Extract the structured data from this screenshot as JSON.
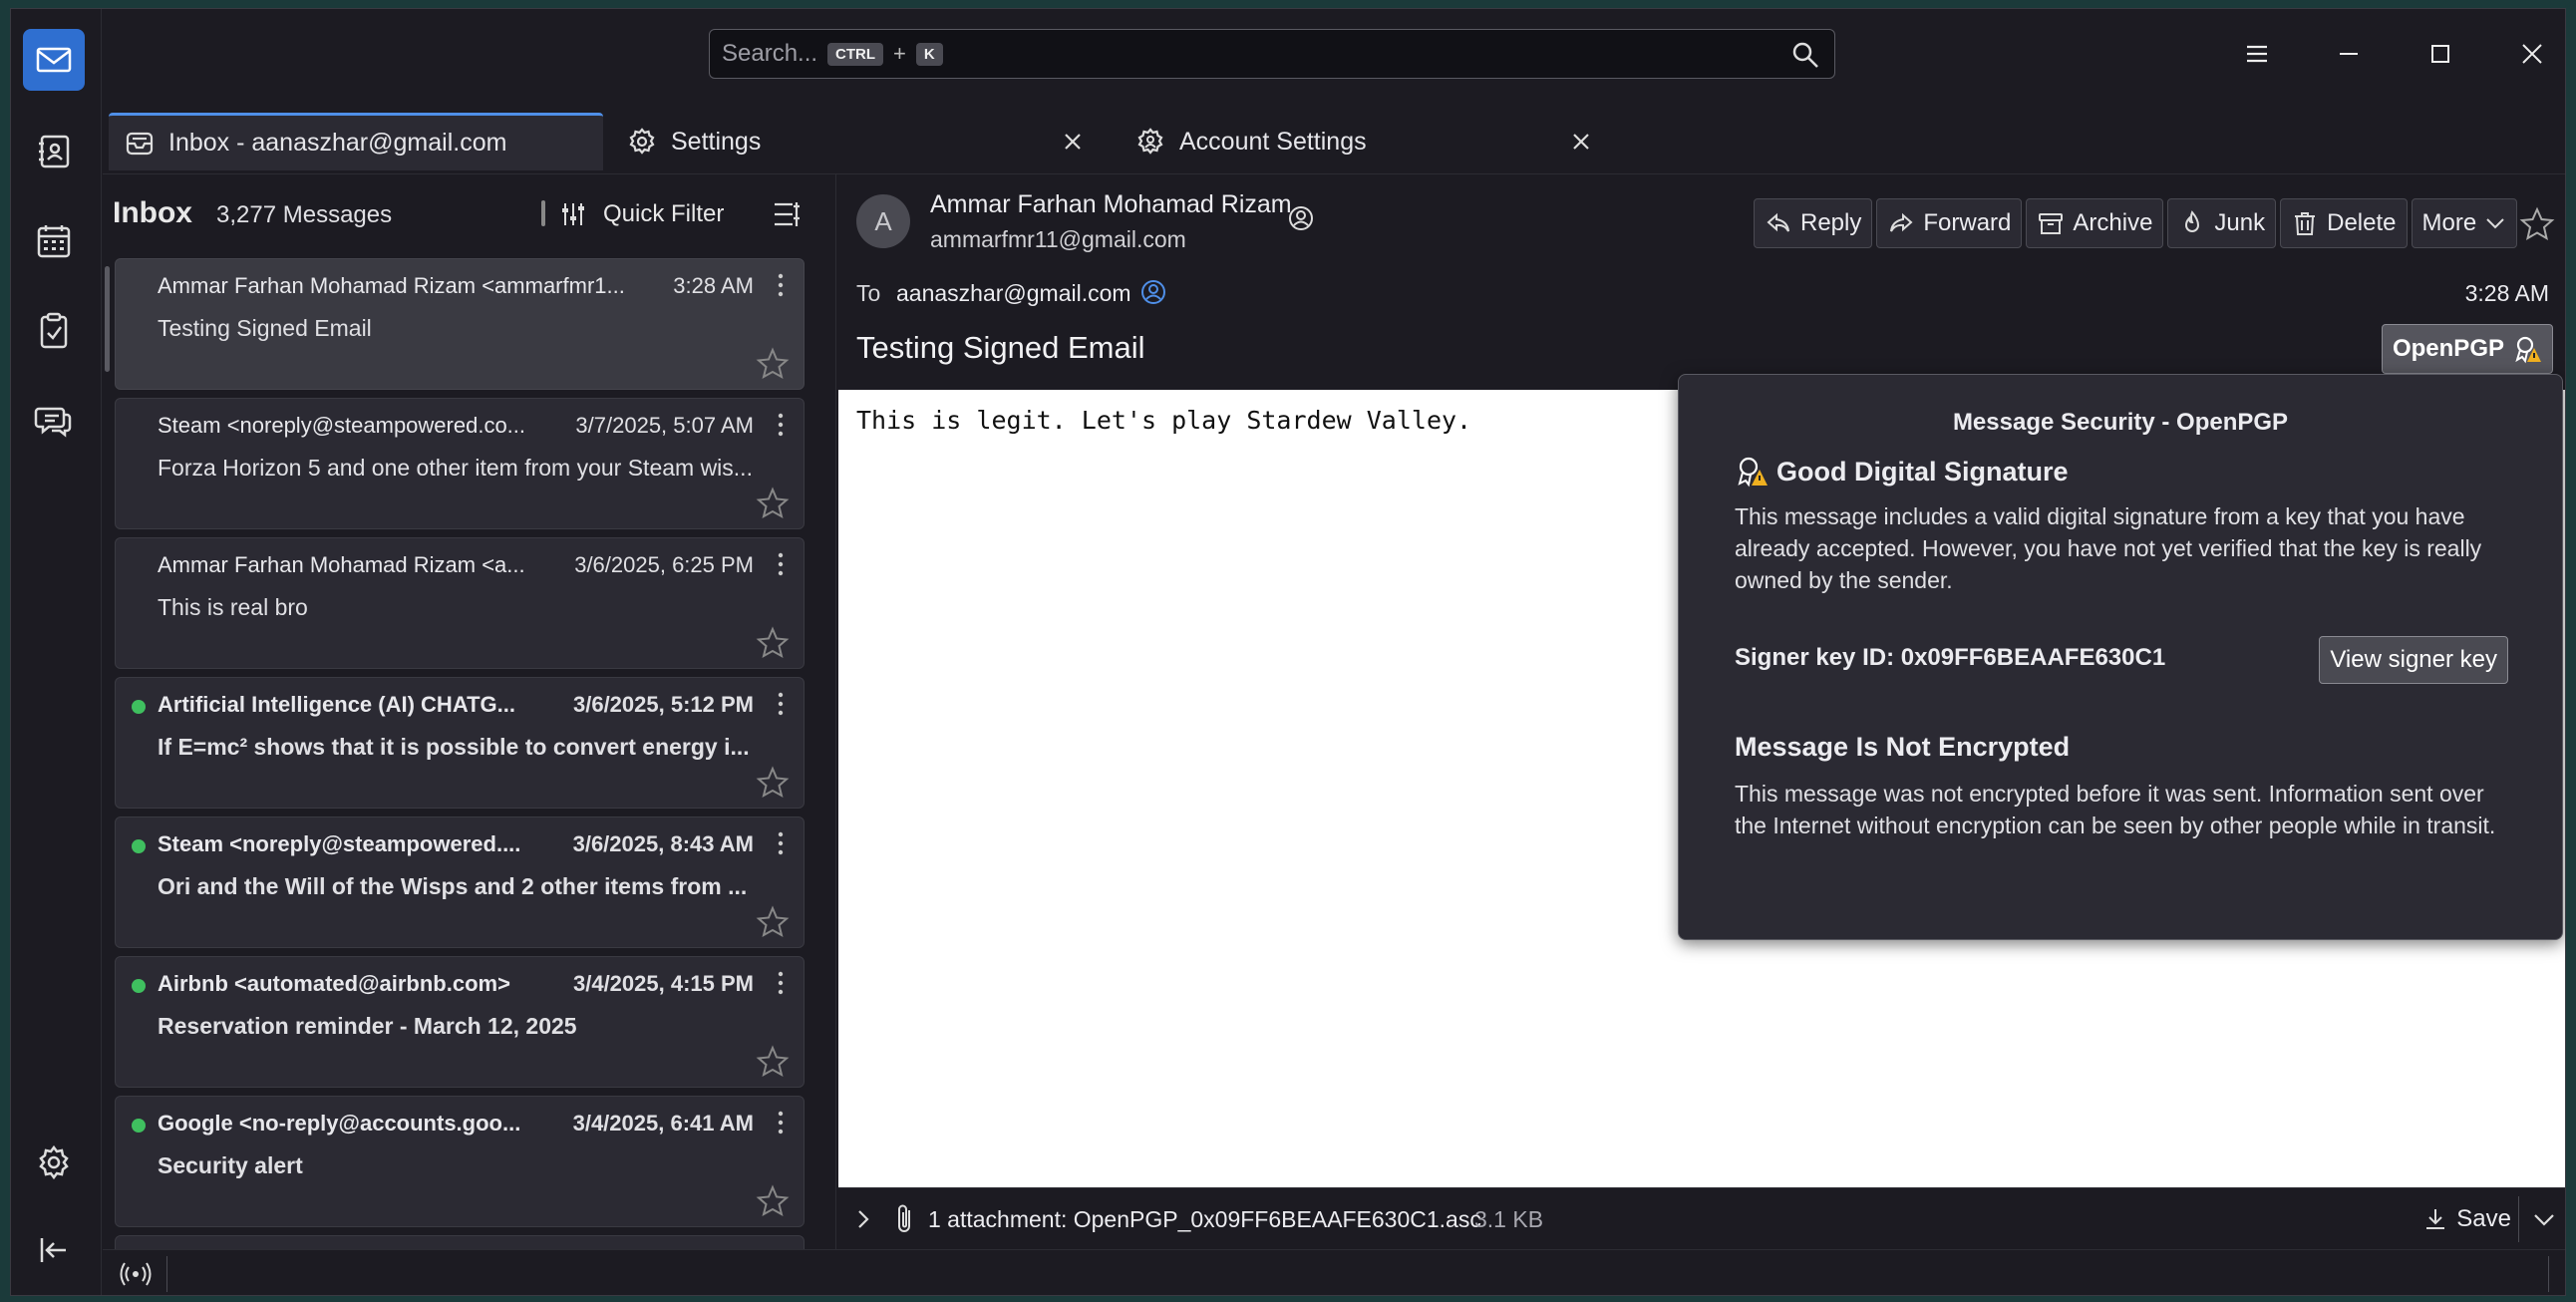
{
  "search": {
    "placeholder": "Search...",
    "kbd_ctrl": "CTRL",
    "kbd_plus": "+",
    "kbd_k": "K"
  },
  "tabs": [
    {
      "label": "Inbox - aanaszhar@gmail.com",
      "icon": "inbox-icon"
    },
    {
      "label": "Settings",
      "icon": "gear-icon"
    },
    {
      "label": "Account Settings",
      "icon": "account-settings-icon"
    }
  ],
  "list": {
    "title": "Inbox",
    "count": "3,277 Messages",
    "quick_filter": "Quick Filter",
    "messages": [
      {
        "from": "Ammar Farhan Mohamad Rizam <ammarfmr1...",
        "date": "3:28 AM",
        "subject": "Testing Signed Email",
        "unread": false,
        "selected": true
      },
      {
        "from": "Steam <noreply@steampowered.co...",
        "date": "3/7/2025, 5:07 AM",
        "subject": "Forza Horizon 5 and one other item from your Steam wis...",
        "unread": false,
        "selected": false
      },
      {
        "from": "Ammar Farhan Mohamad Rizam <a...",
        "date": "3/6/2025, 6:25 PM",
        "subject": "This is real bro",
        "unread": false,
        "selected": false
      },
      {
        "from": "Artificial Intelligence (AI) CHATG...",
        "date": "3/6/2025, 5:12 PM",
        "subject": "If E=mc² shows that it is possible to convert energy i...",
        "unread": true,
        "selected": false
      },
      {
        "from": "Steam <noreply@steampowered....",
        "date": "3/6/2025, 8:43 AM",
        "subject": "Ori and the Will of the Wisps and 2 other items from ...",
        "unread": true,
        "selected": false
      },
      {
        "from": "Airbnb <automated@airbnb.com>",
        "date": "3/4/2025, 4:15 PM",
        "subject": "Reservation reminder - March 12, 2025",
        "unread": true,
        "selected": false
      },
      {
        "from": "Google <no-reply@accounts.goo...",
        "date": "3/4/2025, 6:41 AM",
        "subject": "Security alert",
        "unread": true,
        "selected": false
      }
    ]
  },
  "message": {
    "avatar_letter": "A",
    "sender_name": "Ammar Farhan Mohamad Rizam",
    "sender_email": "ammarfmr11@gmail.com",
    "actions": [
      "Reply",
      "Forward",
      "Archive",
      "Junk",
      "Delete",
      "More"
    ],
    "to_label": "To",
    "to_value": "aanaszhar@gmail.com",
    "time": "3:28 AM",
    "subject": "Testing Signed Email",
    "openpgp_label": "OpenPGP",
    "body": "This is legit. Let's play Stardew Valley.",
    "attachment_text": "1 attachment: OpenPGP_0x09FF6BEAAFE630C1.asc",
    "attachment_size": "3.1 KB",
    "save_label": "Save"
  },
  "security_popup": {
    "title": "Message Security - OpenPGP",
    "sig_heading": "Good Digital Signature",
    "sig_description": "This message includes a valid digital signature from a key that you have already accepted. However, you have not yet verified that the key is really owned by the sender.",
    "signer_key": "Signer key ID: 0x09FF6BEAAFE630C1",
    "view_key_label": "View signer key",
    "enc_heading": "Message Is Not Encrypted",
    "enc_description": "This message was not encrypted before it was sent. Information sent over the Internet without encryption can be seen by other people while in transit."
  },
  "colors": {
    "accent": "#2f6fd0",
    "unread_dot": "#3fbf5f",
    "warning": "#f0b020"
  }
}
